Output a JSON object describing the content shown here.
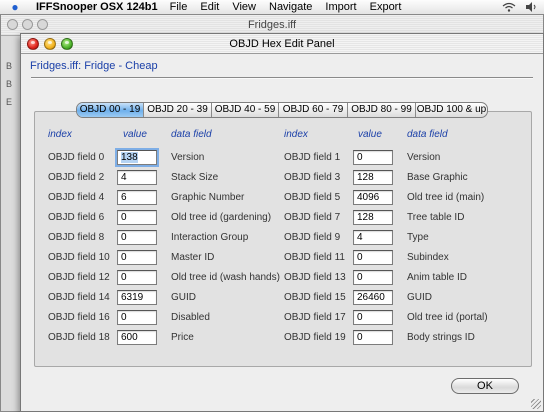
{
  "menubar": {
    "app_name": "IFFSnooper OSX 124b1",
    "items": [
      "File",
      "Edit",
      "View",
      "Navigate",
      "Import",
      "Export"
    ]
  },
  "back_window": {
    "title": "Fridges.iff",
    "side_chars": [
      "B",
      "B",
      "E"
    ]
  },
  "panel": {
    "title": "OBJD Hex Edit Panel",
    "breadcrumb": "Fridges.iff: Fridge - Cheap",
    "tabs": [
      "OBJD 00 - 19",
      "OBJD 20 - 39",
      "OBJD 40 - 59",
      "OBJD 60 - 79",
      "OBJD 80 - 99",
      "OBJD 100 & up"
    ],
    "active_tab": 0,
    "headers": {
      "index": "index",
      "value": "value",
      "data_field": "data field"
    },
    "left_rows": [
      {
        "index": "OBJD field 0",
        "value": "138",
        "name": "Version"
      },
      {
        "index": "OBJD field 2",
        "value": "4",
        "name": "Stack Size"
      },
      {
        "index": "OBJD field 4",
        "value": "6",
        "name": "Graphic Number"
      },
      {
        "index": "OBJD field 6",
        "value": "0",
        "name": "Old tree id (gardening)"
      },
      {
        "index": "OBJD field 8",
        "value": "0",
        "name": "Interaction Group"
      },
      {
        "index": "OBJD field 10",
        "value": "0",
        "name": "Master ID"
      },
      {
        "index": "OBJD field 12",
        "value": "0",
        "name": "Old tree id (wash hands)"
      },
      {
        "index": "OBJD field 14",
        "value": "6319",
        "name": "GUID"
      },
      {
        "index": "OBJD field 16",
        "value": "0",
        "name": "Disabled"
      },
      {
        "index": "OBJD field 18",
        "value": "600",
        "name": "Price"
      }
    ],
    "right_rows": [
      {
        "index": "OBJD field 1",
        "value": "0",
        "name": "Version"
      },
      {
        "index": "OBJD field 3",
        "value": "128",
        "name": "Base Graphic"
      },
      {
        "index": "OBJD field 5",
        "value": "4096",
        "name": "Old tree id (main)"
      },
      {
        "index": "OBJD field 7",
        "value": "128",
        "name": "Tree table ID"
      },
      {
        "index": "OBJD field 9",
        "value": "4",
        "name": "Type"
      },
      {
        "index": "OBJD field 11",
        "value": "0",
        "name": "Subindex"
      },
      {
        "index": "OBJD field 13",
        "value": "0",
        "name": "Anim table ID"
      },
      {
        "index": "OBJD field 15",
        "value": "26460",
        "name": "GUID"
      },
      {
        "index": "OBJD field 17",
        "value": "0",
        "name": "Old tree id (portal)"
      },
      {
        "index": "OBJD field 19",
        "value": "0",
        "name": "Body strings ID"
      }
    ],
    "ok_label": "OK"
  },
  "colors": {
    "label_blue": "#1a3fa8",
    "tab_active": "#6fb0ec"
  }
}
